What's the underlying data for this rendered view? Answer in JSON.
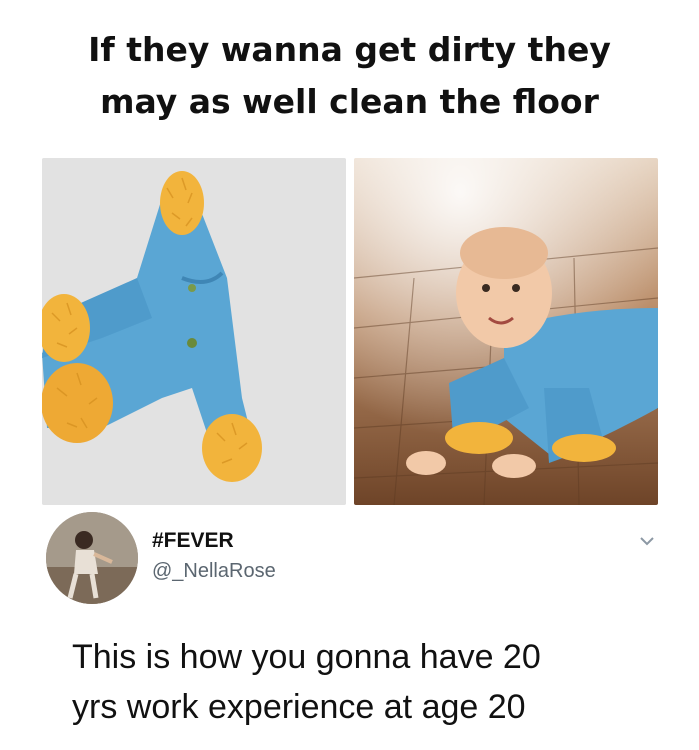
{
  "headline": {
    "line1": "If they wanna get dirty they",
    "line2": "may as well clean the floor"
  },
  "images": {
    "left": "baby-romper-with-mop-sleeves-flat",
    "right": "baby-wearing-mop-romper-crawling"
  },
  "tweet": {
    "display_name": "#FEVER",
    "username": "@_NellaRose",
    "text_line1": "This is how you gonna have 20",
    "text_line2": "yrs work experience at age 20",
    "chevron_icon": "chevron-down-icon"
  },
  "colors": {
    "romper": "#5aa6d4",
    "mop": "#f2b43c",
    "floor": "#8a5b3a",
    "background": "#ffffff"
  }
}
